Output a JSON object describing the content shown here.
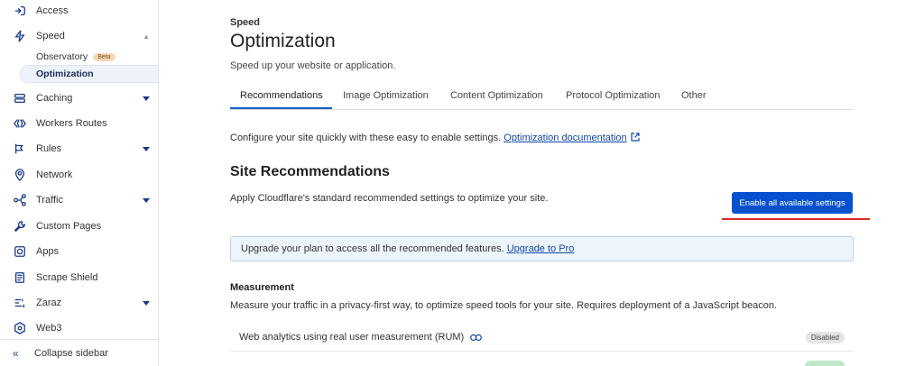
{
  "sidebar": {
    "items": [
      {
        "label": "Access",
        "icon": "access-icon"
      },
      {
        "label": "Speed",
        "icon": "lightning-icon"
      },
      {
        "label": "Caching",
        "icon": "caching-icon"
      },
      {
        "label": "Workers Routes",
        "icon": "workers-icon"
      },
      {
        "label": "Rules",
        "icon": "rules-icon"
      },
      {
        "label": "Network",
        "icon": "network-icon"
      },
      {
        "label": "Traffic",
        "icon": "traffic-icon"
      },
      {
        "label": "Custom Pages",
        "icon": "wrench-icon"
      },
      {
        "label": "Apps",
        "icon": "apps-icon"
      },
      {
        "label": "Scrape Shield",
        "icon": "document-icon"
      },
      {
        "label": "Zaraz",
        "icon": "zaraz-icon"
      },
      {
        "label": "Web3",
        "icon": "web3-icon"
      }
    ],
    "speed_sub": {
      "observatory": "Observatory",
      "beta": "Beta",
      "optimization": "Optimization"
    },
    "collapse_label": "Collapse sidebar"
  },
  "main": {
    "eyebrow": "Speed",
    "title": "Optimization",
    "subtitle": "Speed up your website or application.",
    "tabs": [
      {
        "label": "Recommendations",
        "active": true
      },
      {
        "label": "Image Optimization"
      },
      {
        "label": "Content Optimization"
      },
      {
        "label": "Protocol Optimization"
      },
      {
        "label": "Other"
      }
    ],
    "intro_text": "Configure your site quickly with these easy to enable settings.",
    "intro_link": "Optimization documentation",
    "section_title": "Site Recommendations",
    "section_desc": "Apply Cloudflare's standard recommended settings to optimize your site.",
    "enable_button": "Enable all available settings",
    "upgrade_text": "Upgrade your plan to access all the recommended features.",
    "upgrade_link": "Upgrade to Pro",
    "measurement_title": "Measurement",
    "measurement_desc": "Measure your traffic in a privacy-first way, to optimize speed tools for your site. Requires deployment of a JavaScript beacon.",
    "rows": [
      {
        "label": "Web analytics using real user measurement (RUM)",
        "status": "Disabled"
      }
    ]
  },
  "colors": {
    "accent": "#0751cf",
    "link": "#0c47a8",
    "annotation": "#e02424",
    "sidebar_icon": "#1a3a8a"
  }
}
